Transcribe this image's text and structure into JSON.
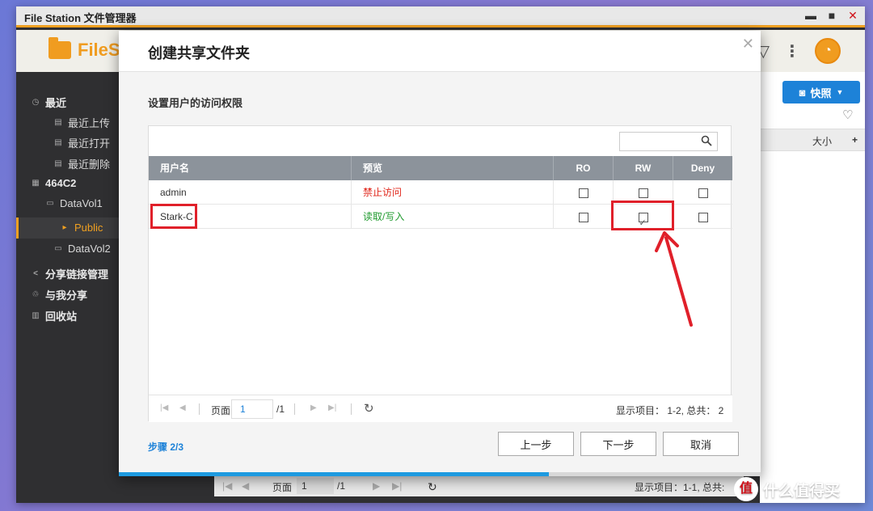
{
  "window": {
    "title": "File Station 文件管理器",
    "app_name": "FileS",
    "controls": {
      "minimize": "▬",
      "maximize": "■",
      "close": "✕"
    }
  },
  "sidebar": {
    "items": [
      {
        "label": "最近",
        "icon": "clock-icon",
        "level": 0
      },
      {
        "label": "最近上传",
        "icon": "doc-icon",
        "level": 1
      },
      {
        "label": "最近打开",
        "icon": "doc-icon",
        "level": 1
      },
      {
        "label": "最近删除",
        "icon": "doc-icon",
        "level": 1
      },
      {
        "label": "464C2",
        "icon": "nas-icon",
        "level": 0
      },
      {
        "label": "DataVol1",
        "icon": "drive-icon",
        "level": 1
      },
      {
        "label": "Public",
        "icon": "folder-icon",
        "level": 2,
        "active": true
      },
      {
        "label": "DataVol2",
        "icon": "drive-icon",
        "level": 1
      },
      {
        "label": "分享链接管理",
        "icon": "share-icon",
        "level": 0
      },
      {
        "label": "与我分享",
        "icon": "shared-icon",
        "level": 0
      },
      {
        "label": "回收站",
        "icon": "trash-icon",
        "level": 0
      }
    ]
  },
  "right_pane": {
    "snapshot_label": "快照",
    "size_column": "大小",
    "add_column": "+"
  },
  "background_pager": {
    "page_label": "页面",
    "page_value": "1",
    "page_total": "/1",
    "status": "显示项目：1-1, 总共:"
  },
  "modal": {
    "title": "创建共享文件夹",
    "section_title": "设置用户的访问权限",
    "search": {
      "placeholder": ""
    },
    "columns": [
      "用户名",
      "预览",
      "RO",
      "RW",
      "Deny"
    ],
    "rows": [
      {
        "user": "admin",
        "preview": "禁止访问",
        "preview_status": "deny",
        "ro": false,
        "rw": false,
        "deny": false
      },
      {
        "user": "Stark-C",
        "preview": "读取/写入",
        "preview_status": "allow",
        "ro": false,
        "rw": true,
        "deny": false
      }
    ],
    "pager": {
      "page_label": "页面",
      "page_value": "1",
      "page_total": "/1",
      "status": "显示项目： 1-2, 总共： 2"
    },
    "step": "步骤 2/3",
    "buttons": {
      "prev": "上一步",
      "next": "下一步",
      "cancel": "取消"
    },
    "progress": 0.67
  },
  "watermark": {
    "text": "什么值得买",
    "badge": "值"
  },
  "colors": {
    "accent_orange": "#f09c20",
    "accent_blue": "#1d82d8",
    "deny_red": "#e0261a",
    "allow_green": "#1f9a2e",
    "annotation_red": "#e0202a"
  }
}
